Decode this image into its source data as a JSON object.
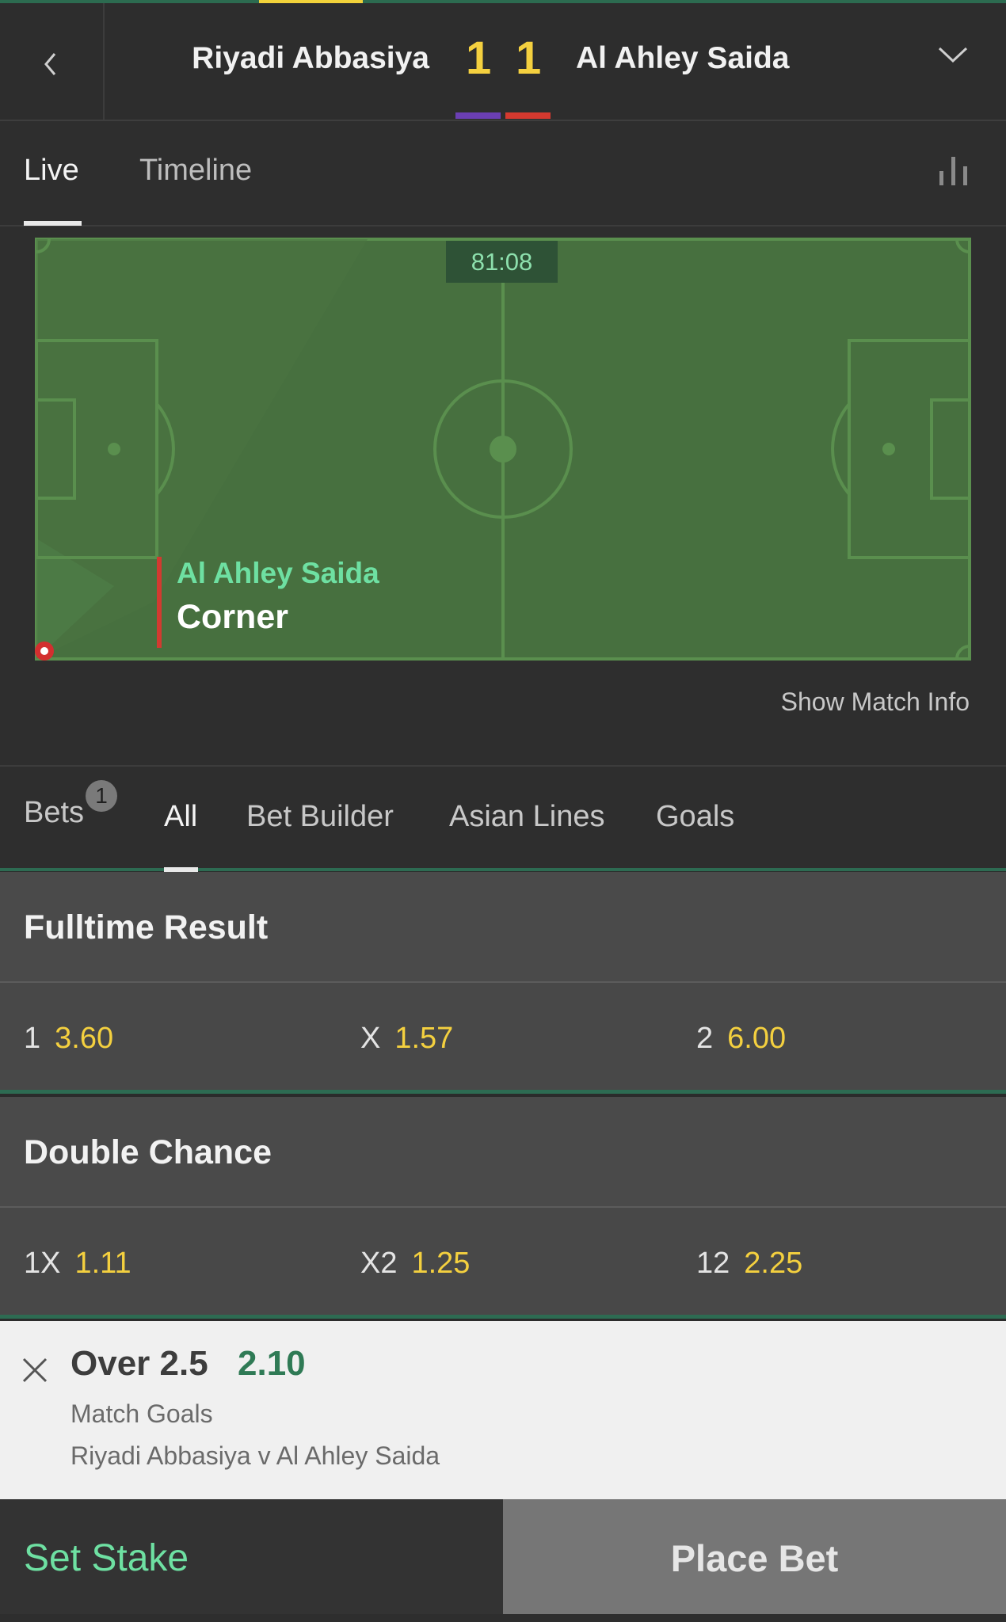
{
  "header": {
    "home_team": "Riyadi Abbasiya",
    "away_team": "Al Ahley Saida",
    "home_score": "1",
    "away_score": "1",
    "colors": {
      "home": "#6b3fb3",
      "away": "#d4392f",
      "score": "#f4d03f"
    }
  },
  "view_tabs": [
    {
      "label": "Live",
      "active": true
    },
    {
      "label": "Timeline",
      "active": false
    }
  ],
  "pitch": {
    "clock": "81:08",
    "event_team": "Al Ahley Saida",
    "event_type": "Corner",
    "show_info_label": "Show Match Info"
  },
  "market_tabs": {
    "bets_label": "Bets",
    "bets_count": "1",
    "items": [
      "All",
      "Bet Builder",
      "Asian Lines",
      "Goals"
    ],
    "active": "All"
  },
  "markets": [
    {
      "title": "Fulltime Result",
      "selections": [
        {
          "label": "1",
          "odds": "3.60"
        },
        {
          "label": "X",
          "odds": "1.57"
        },
        {
          "label": "2",
          "odds": "6.00"
        }
      ]
    },
    {
      "title": "Double Chance",
      "selections": [
        {
          "label": "1X",
          "odds": "1.11"
        },
        {
          "label": "X2",
          "odds": "1.25"
        },
        {
          "label": "12",
          "odds": "2.25"
        }
      ]
    }
  ],
  "bet_slip": {
    "selection": "Over 2.5",
    "odds": "2.10",
    "market": "Match Goals",
    "event": "Riyadi Abbasiya v Al Ahley Saida"
  },
  "actions": {
    "set_stake": "Set Stake",
    "place_bet": "Place Bet"
  },
  "icons": [
    "chevron-left-icon",
    "chevron-down-icon",
    "stats-icon",
    "close-icon"
  ]
}
